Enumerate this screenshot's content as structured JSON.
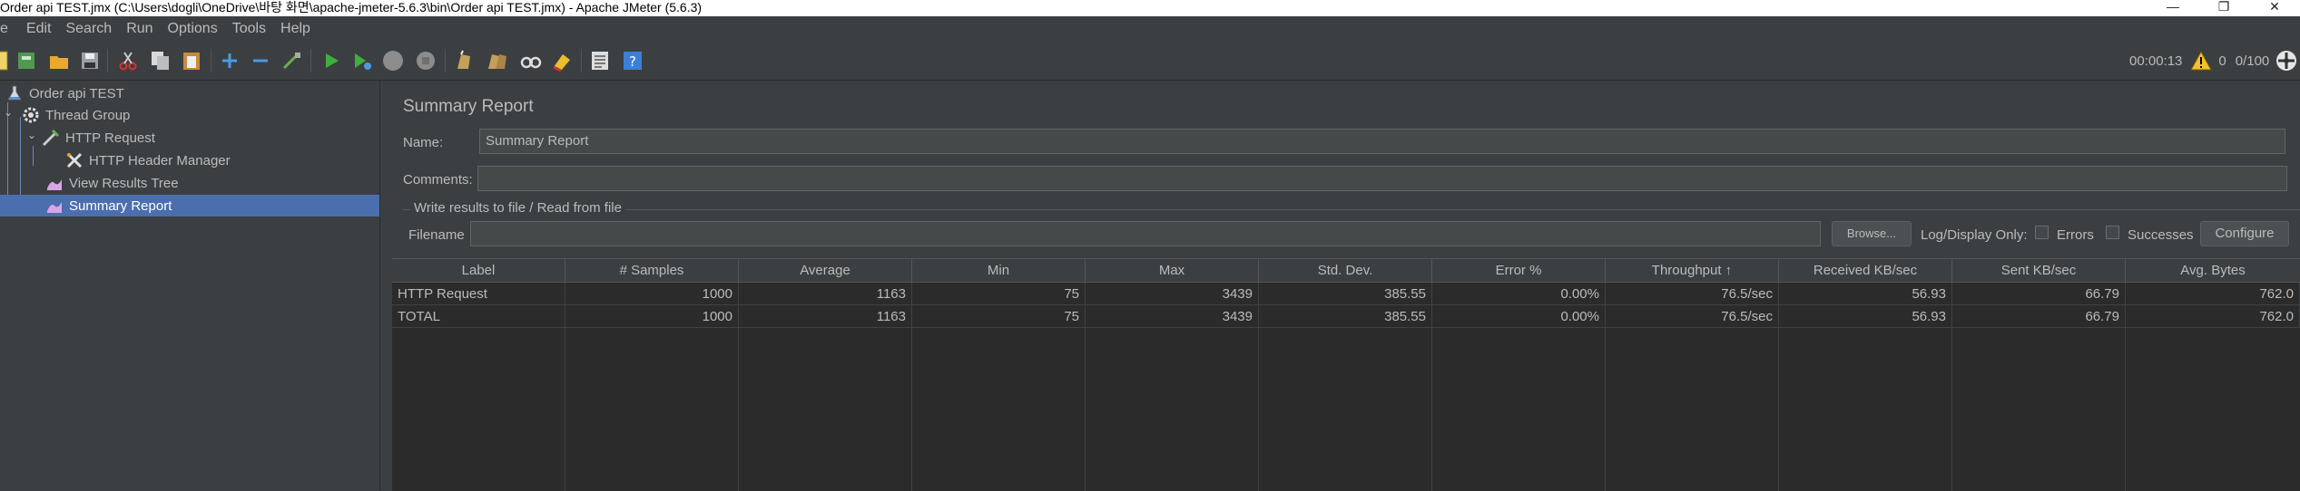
{
  "window": {
    "title": "Order api TEST.jmx (C:\\Users\\dogli\\OneDrive\\바탕 화면\\apache-jmeter-5.6.3\\bin\\Order api TEST.jmx) - Apache JMeter (5.6.3)",
    "minimize": "—",
    "maximize": "❐",
    "close": "✕"
  },
  "menu": [
    {
      "label": "e"
    },
    {
      "label": "Edit"
    },
    {
      "label": "Search"
    },
    {
      "label": "Run"
    },
    {
      "label": "Options"
    },
    {
      "label": "Tools"
    },
    {
      "label": "Help"
    }
  ],
  "toolbar": {
    "icons": [
      "new-icon",
      "templates-icon",
      "open-icon",
      "save-icon",
      "cut-icon",
      "copy-icon",
      "paste-icon",
      "expand-icon",
      "collapse-icon",
      "toggle-icon",
      "start-icon",
      "start-no-pause-icon",
      "stop-icon",
      "shutdown-icon",
      "clear-icon",
      "clear-all-icon",
      "search-icon",
      "reset-search-icon",
      "function-helper-icon",
      "help-icon"
    ],
    "elapsed": "00:00:13",
    "warnings": "0",
    "threads": "0/100"
  },
  "tree": {
    "items": [
      {
        "label": "Order api TEST",
        "icon": "test-plan-icon"
      },
      {
        "label": "Thread Group",
        "icon": "gear-icon"
      },
      {
        "label": "HTTP Request",
        "icon": "sampler-icon"
      },
      {
        "label": "HTTP Header Manager",
        "icon": "config-tools-icon"
      },
      {
        "label": "View Results Tree",
        "icon": "listener-icon"
      },
      {
        "label": "Summary Report",
        "icon": "listener-icon"
      }
    ]
  },
  "report": {
    "heading": "Summary Report",
    "name_label": "Name:",
    "name_value": "Summary Report",
    "comments_label": "Comments:",
    "comments_value": "",
    "file_section": "Write results to file / Read from file",
    "filename_label": "Filename",
    "filename_value": "",
    "browse_label": "Browse...",
    "log_display_label": "Log/Display Only:",
    "errors_label": "Errors",
    "successes_label": "Successes",
    "configure_label": "Configure"
  },
  "table": {
    "columns": [
      "Label",
      "# Samples",
      "Average",
      "Min",
      "Max",
      "Std. Dev.",
      "Error %",
      "Throughput ↑",
      "Received KB/sec",
      "Sent KB/sec",
      "Avg. Bytes"
    ],
    "rows": [
      [
        "HTTP Request",
        "1000",
        "1163",
        "75",
        "3439",
        "385.55",
        "0.00%",
        "76.5/sec",
        "56.93",
        "66.79",
        "762.0"
      ],
      [
        "TOTAL",
        "1000",
        "1163",
        "75",
        "3439",
        "385.55",
        "0.00%",
        "76.5/sec",
        "56.93",
        "66.79",
        "762.0"
      ]
    ]
  }
}
